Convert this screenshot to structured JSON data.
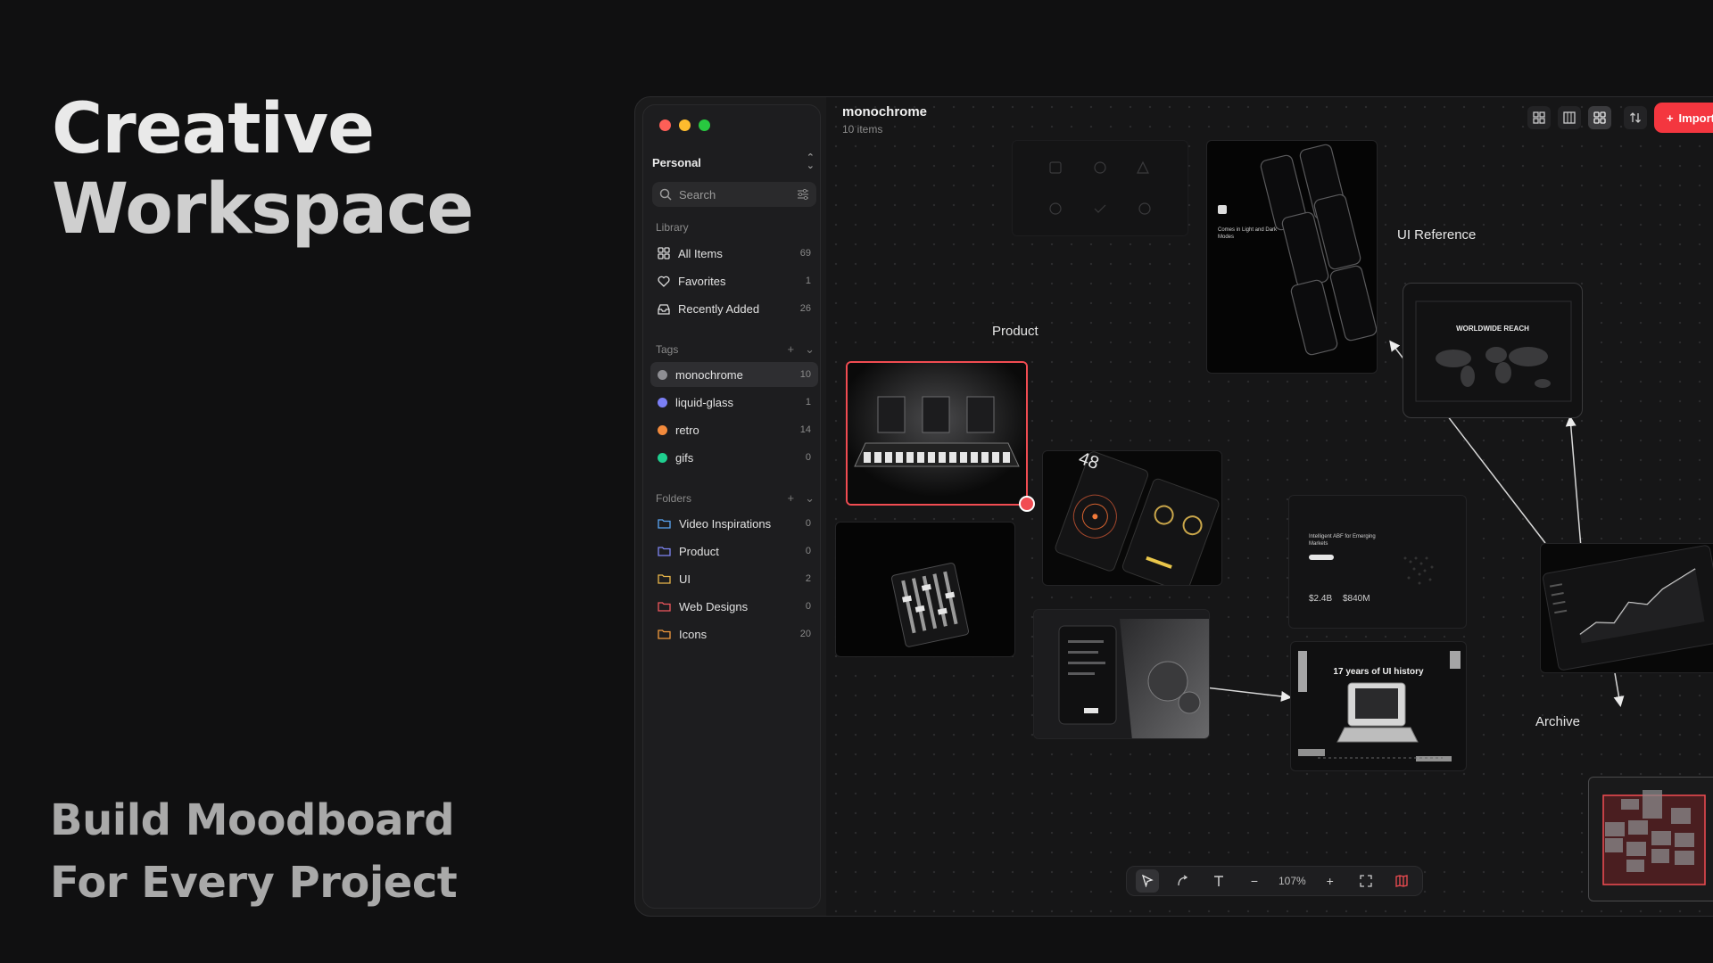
{
  "hero": {
    "title_line1": "Creative",
    "title_line2": "Workspace",
    "sub_line1": "Build Moodboard",
    "sub_line2": "For Every Project"
  },
  "sidebar": {
    "workspace": "Personal",
    "search_placeholder": "Search",
    "library_label": "Library",
    "library": [
      {
        "label": "All Items",
        "count": "69",
        "icon": "grid-icon"
      },
      {
        "label": "Favorites",
        "count": "1",
        "icon": "heart-icon"
      },
      {
        "label": "Recently Added",
        "count": "26",
        "icon": "inbox-icon"
      }
    ],
    "tags_label": "Tags",
    "tags": [
      {
        "label": "monochrome",
        "count": "10",
        "color": "#8e8e93"
      },
      {
        "label": "liquid-glass",
        "count": "1",
        "color": "#7b7ff5"
      },
      {
        "label": "retro",
        "count": "14",
        "color": "#f28a3c"
      },
      {
        "label": "gifs",
        "count": "0",
        "color": "#1fcf8f"
      }
    ],
    "folders_label": "Folders",
    "folders": [
      {
        "label": "Video Inspirations",
        "count": "0",
        "color": "#5aa7f7"
      },
      {
        "label": "Product",
        "count": "0",
        "color": "#7f86f4"
      },
      {
        "label": "UI",
        "count": "2",
        "color": "#e9b64a"
      },
      {
        "label": "Web Designs",
        "count": "0",
        "color": "#f0575d"
      },
      {
        "label": "Icons",
        "count": "20",
        "color": "#f29a3c"
      }
    ]
  },
  "canvas": {
    "title": "monochrome",
    "subtitle": "10 items",
    "import_label": "Import",
    "labels": {
      "product": "Product",
      "ui_reference": "UI Reference",
      "archive": "Archive"
    },
    "card_texts": {
      "worldwide": "WORLDWIDE REACH",
      "ui_history": "17 years of UI history",
      "abf_title": "Intelligent ABF for Emerging Markets",
      "stat1": "$2.4B",
      "stat2": "$840M",
      "phones_caption": "Comes in Light and Dark Modes",
      "dial_number": "48"
    },
    "zoom": "107%"
  },
  "colors": {
    "accent": "#f4363f",
    "selection": "#f14c52"
  }
}
